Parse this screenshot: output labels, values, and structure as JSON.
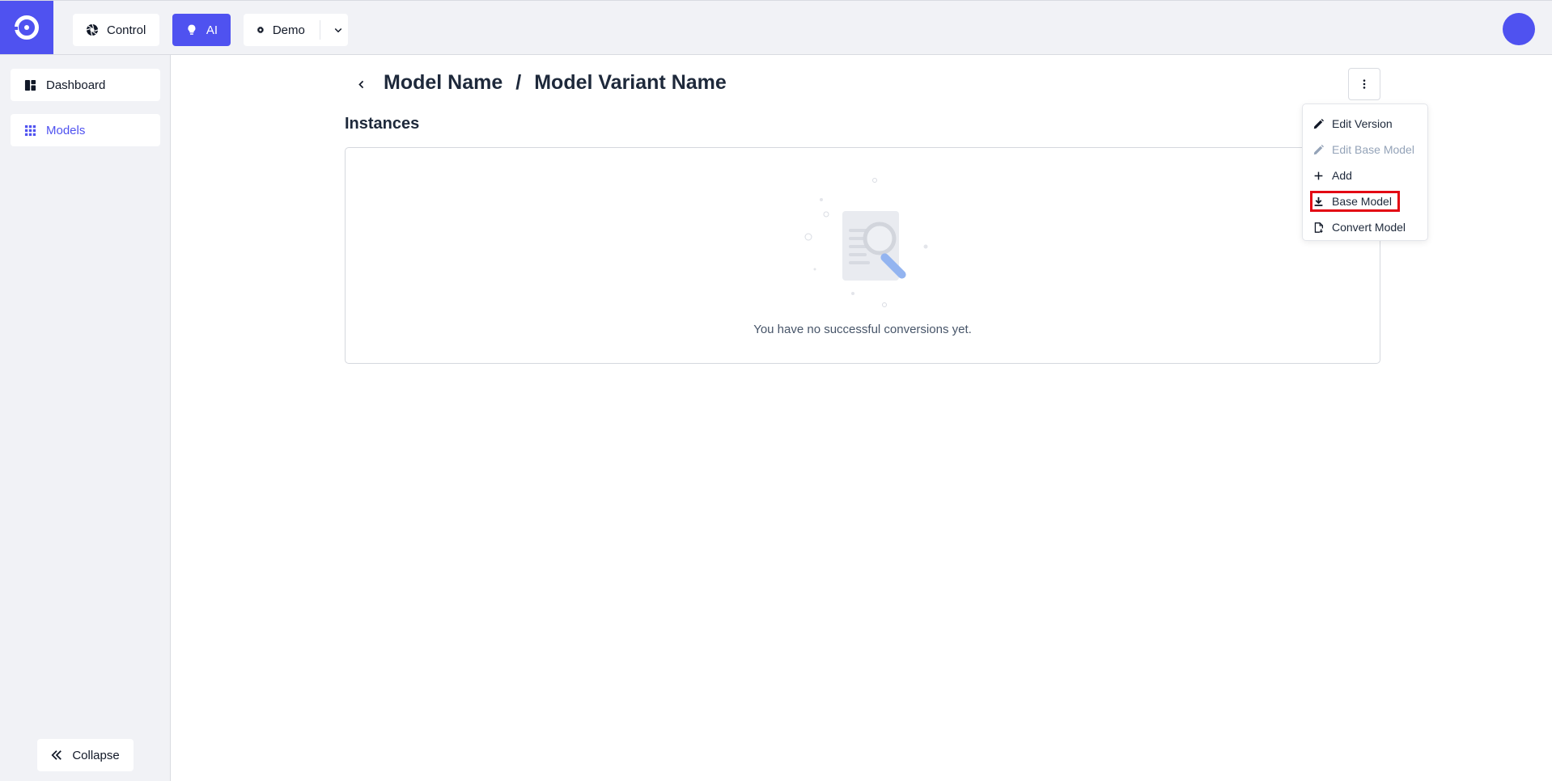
{
  "topbar": {
    "control_label": "Control",
    "ai_label": "AI",
    "demo_label": "Demo"
  },
  "sidebar": {
    "items": [
      {
        "label": "Dashboard"
      },
      {
        "label": "Models"
      }
    ],
    "collapse_label": "Collapse"
  },
  "header": {
    "model_name": "Model Name",
    "separator": "/",
    "variant_name": "Model Variant Name"
  },
  "instances": {
    "title": "Instances",
    "empty_message": "You have no successful conversions yet."
  },
  "menu": {
    "items": [
      {
        "label": "Edit Version",
        "icon": "pencil-icon",
        "disabled": false
      },
      {
        "label": "Edit Base Model",
        "icon": "pencil-icon",
        "disabled": true
      },
      {
        "label": "Add",
        "icon": "plus-icon",
        "disabled": false
      },
      {
        "label": "Base Model",
        "icon": "download-icon",
        "disabled": false,
        "highlighted": true
      },
      {
        "label": "Convert Model",
        "icon": "file-convert-icon",
        "disabled": false
      }
    ]
  },
  "colors": {
    "accent": "#4f52f0",
    "highlight": "#e30613"
  }
}
